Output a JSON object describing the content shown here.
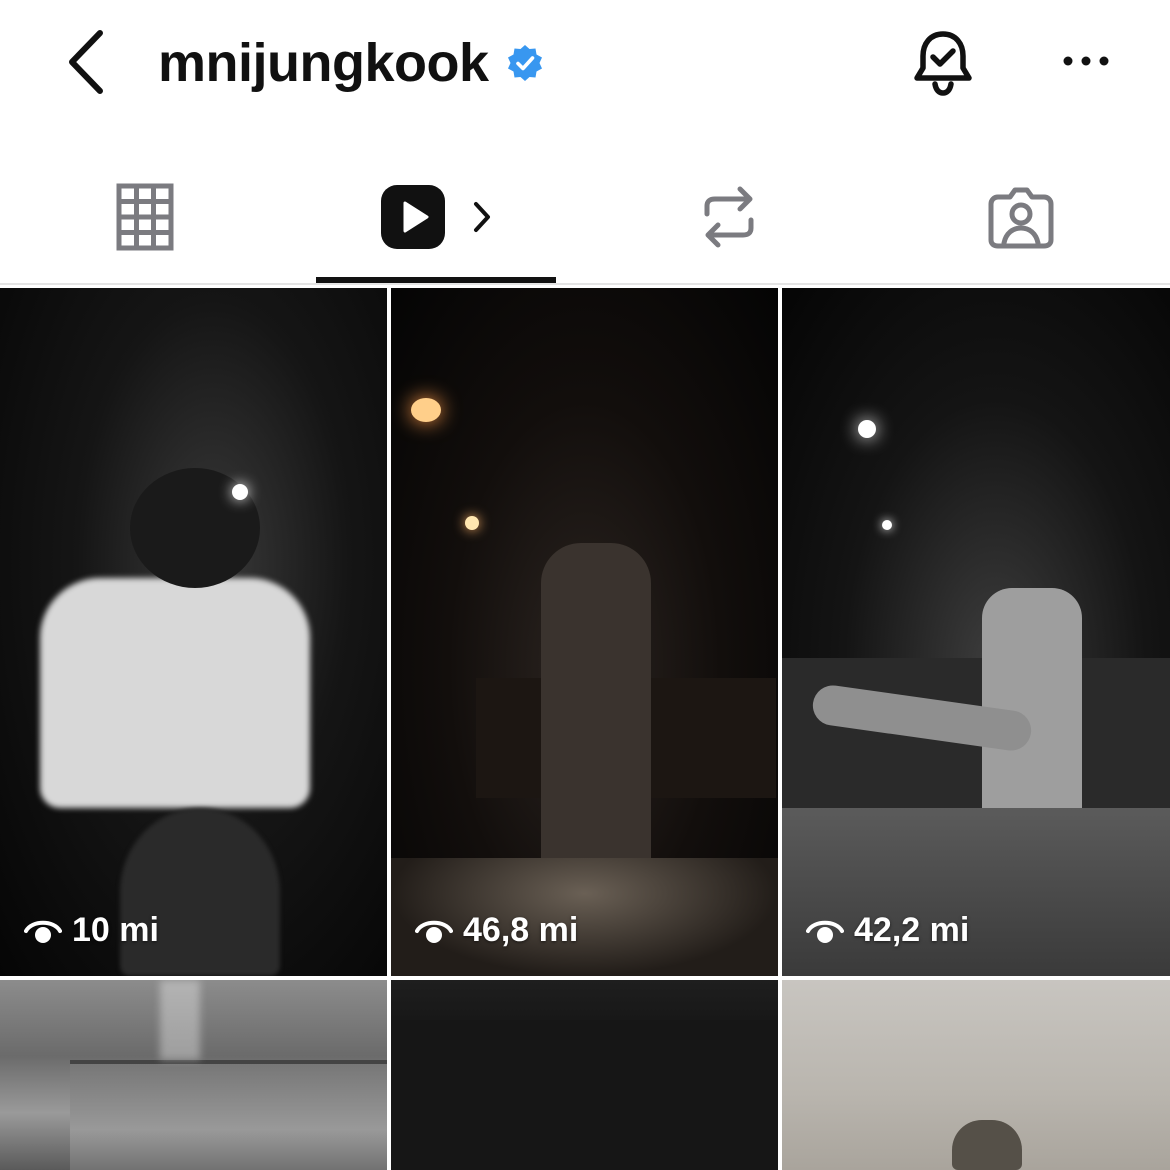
{
  "header": {
    "username": "mnijungkook",
    "verified": true,
    "accent_color": "#3897f0"
  },
  "tabs": [
    {
      "name": "posts",
      "icon": "grid-icon",
      "active": false
    },
    {
      "name": "reels",
      "icon": "reels-play-icon",
      "active": true
    },
    {
      "name": "reposts",
      "icon": "repost-icon",
      "active": false
    },
    {
      "name": "tagged",
      "icon": "tagged-person-icon",
      "active": false
    }
  ],
  "grid": {
    "items": [
      {
        "views": "10 mi",
        "icon": "eye-icon"
      },
      {
        "views": "46,8 mi",
        "icon": "eye-icon"
      },
      {
        "views": "42,2 mi",
        "icon": "eye-icon"
      },
      {
        "views": null
      },
      {
        "views": null
      },
      {
        "views": null
      }
    ]
  }
}
